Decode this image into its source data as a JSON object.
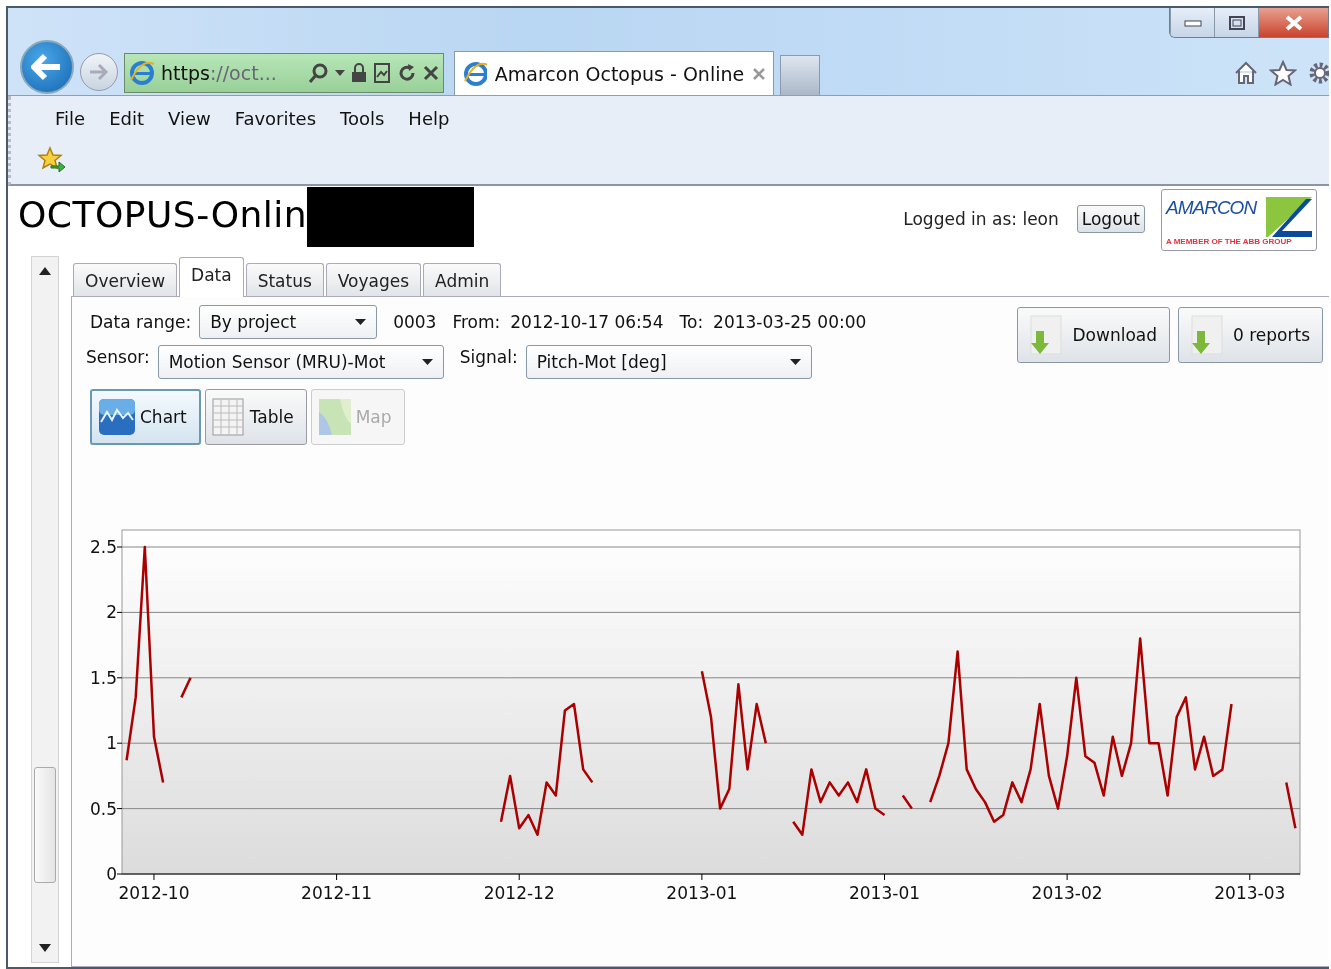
{
  "browser": {
    "address_scheme": "https",
    "address_rest": "://oct...",
    "tab_title": "Amarcon Octopus - Online"
  },
  "menu": [
    "File",
    "Edit",
    "View",
    "Favorites",
    "Tools",
    "Help"
  ],
  "page": {
    "title": "OCTOPUS-Onlin",
    "login_text": "Logged in as: leon",
    "logout": "Logout",
    "logo": {
      "name": "AMARCON",
      "tagline": "A MEMBER OF THE ABB GROUP"
    }
  },
  "tabs": [
    {
      "label": "Overview",
      "selected": false
    },
    {
      "label": "Data",
      "selected": true
    },
    {
      "label": "Status",
      "selected": false
    },
    {
      "label": "Voyages",
      "selected": false
    },
    {
      "label": "Admin",
      "selected": false
    }
  ],
  "filters": {
    "data_range_label": "Data range:",
    "data_range_value": "By project",
    "project": "0003",
    "from_label": "From:",
    "from_value": "2012-10-17 06:54",
    "to_label": "To:",
    "to_value": "2013-03-25 00:00",
    "sensor_label": "Sensor:",
    "sensor_value": "Motion Sensor (MRU)-Mot",
    "signal_label": "Signal:",
    "signal_value": "Pitch-Mot [deg]"
  },
  "actions": [
    "Download",
    "0 reports"
  ],
  "views": [
    {
      "label": "Chart",
      "kind": "chart",
      "selected": true,
      "disabled": false
    },
    {
      "label": "Table",
      "kind": "table",
      "selected": false,
      "disabled": false
    },
    {
      "label": "Map",
      "kind": "map",
      "selected": false,
      "disabled": true
    }
  ],
  "chart": {
    "chart_data": {
      "type": "line",
      "grid": true,
      "ylim": [
        0,
        2.63
      ],
      "yticks": [
        0,
        0.5,
        1,
        1.5,
        2,
        2.5
      ],
      "categories": [
        null,
        null,
        null,
        "2012-10",
        null,
        null,
        null,
        null,
        null,
        null,
        null,
        null,
        null,
        null,
        null,
        null,
        null,
        null,
        null,
        null,
        null,
        null,
        null,
        "2012-11",
        null,
        null,
        null,
        null,
        null,
        null,
        null,
        null,
        null,
        null,
        null,
        null,
        null,
        null,
        null,
        null,
        null,
        null,
        null,
        "2012-12",
        null,
        null,
        null,
        null,
        null,
        null,
        null,
        null,
        null,
        null,
        null,
        null,
        null,
        null,
        null,
        null,
        null,
        null,
        null,
        "2013-01",
        null,
        null,
        null,
        null,
        null,
        null,
        null,
        null,
        null,
        null,
        null,
        null,
        null,
        null,
        null,
        null,
        null,
        null,
        null,
        "2013-01",
        null,
        null,
        null,
        null,
        null,
        null,
        null,
        null,
        null,
        null,
        null,
        null,
        null,
        null,
        null,
        null,
        null,
        null,
        null,
        "2013-02",
        null,
        null,
        null,
        null,
        null,
        null,
        null,
        null,
        null,
        null,
        null,
        null,
        null,
        null,
        null,
        null,
        null,
        null,
        null,
        "2013-03",
        null,
        null,
        null,
        null,
        null
      ],
      "series": [
        {
          "color": "#aa0000",
          "values": [
            0.87,
            1.35,
            2.5,
            1.05,
            0.7,
            null,
            1.35,
            1.5,
            null,
            null,
            null,
            null,
            null,
            null,
            null,
            null,
            null,
            null,
            null,
            null,
            null,
            null,
            null,
            null,
            null,
            null,
            null,
            null,
            null,
            null,
            null,
            null,
            null,
            null,
            null,
            null,
            null,
            null,
            null,
            null,
            null,
            0.4,
            0.75,
            0.35,
            0.45,
            0.3,
            0.7,
            0.6,
            1.25,
            1.3,
            0.8,
            0.7,
            null,
            null,
            null,
            null,
            null,
            null,
            null,
            null,
            null,
            null,
            null,
            1.55,
            1.2,
            0.5,
            0.65,
            1.45,
            0.8,
            1.3,
            1.0,
            null,
            null,
            0.4,
            0.3,
            0.8,
            0.55,
            0.7,
            0.6,
            0.7,
            0.55,
            0.8,
            0.5,
            0.45,
            null,
            0.6,
            0.5,
            null,
            0.55,
            0.75,
            1.0,
            1.7,
            0.8,
            0.65,
            0.55,
            0.4,
            0.45,
            0.7,
            0.55,
            0.8,
            1.3,
            0.75,
            0.5,
            0.9,
            1.5,
            0.9,
            0.85,
            0.6,
            1.05,
            0.75,
            1.0,
            1.8,
            1.0,
            1.0,
            0.6,
            1.2,
            1.35,
            0.8,
            1.05,
            0.75,
            0.8,
            1.3,
            null,
            null,
            null,
            null,
            null,
            0.7,
            0.35
          ]
        }
      ]
    }
  }
}
